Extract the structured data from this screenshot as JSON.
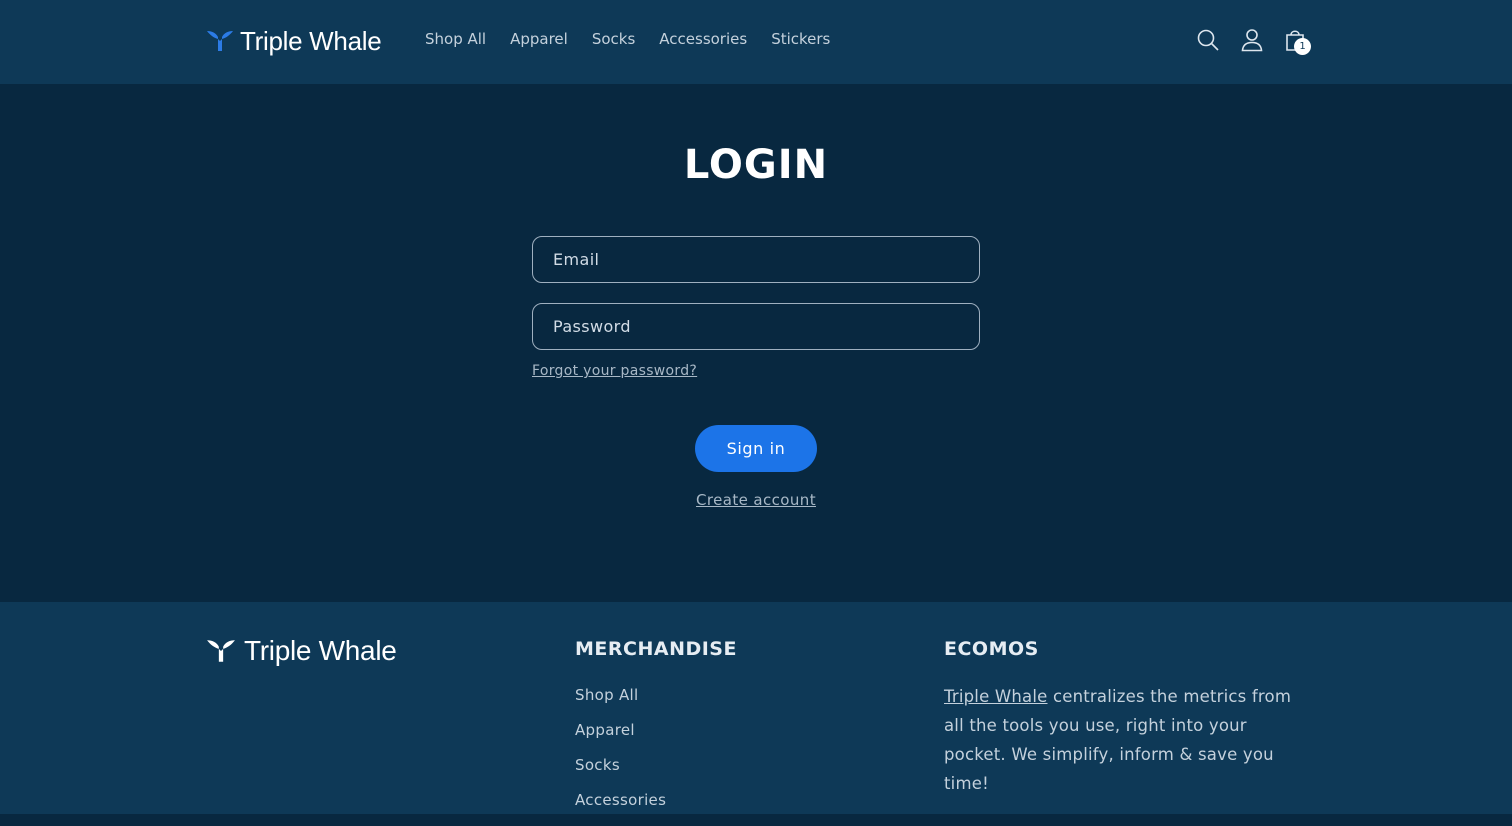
{
  "header": {
    "brand": "Triple Whale",
    "nav": [
      "Shop All",
      "Apparel",
      "Socks",
      "Accessories",
      "Stickers"
    ],
    "icons": {
      "search": "search-icon",
      "account": "user-icon",
      "cart": "shopping-bag-icon"
    },
    "cart_count": "1"
  },
  "main": {
    "title": "LOGIN",
    "email_placeholder": "Email",
    "password_placeholder": "Password",
    "forgot_link": "Forgot your password?",
    "signin_button": "Sign in",
    "create_account": "Create account"
  },
  "footer": {
    "brand": "Triple Whale",
    "merch_heading": "MERCHANDISE",
    "merch_links": [
      "Shop All",
      "Apparel",
      "Socks",
      "Accessories"
    ],
    "ecomos_heading": "ECOMOS",
    "ecomos_link": "Triple Whale",
    "ecomos_text": " centralizes the metrics from all the tools you use, right into your pocket. We simplify, inform & save you time!"
  },
  "colors": {
    "header_bg": "#0e3957",
    "page_bg": "#082840",
    "accent": "#1c74e8",
    "logo_mark": "#2c7be5"
  }
}
